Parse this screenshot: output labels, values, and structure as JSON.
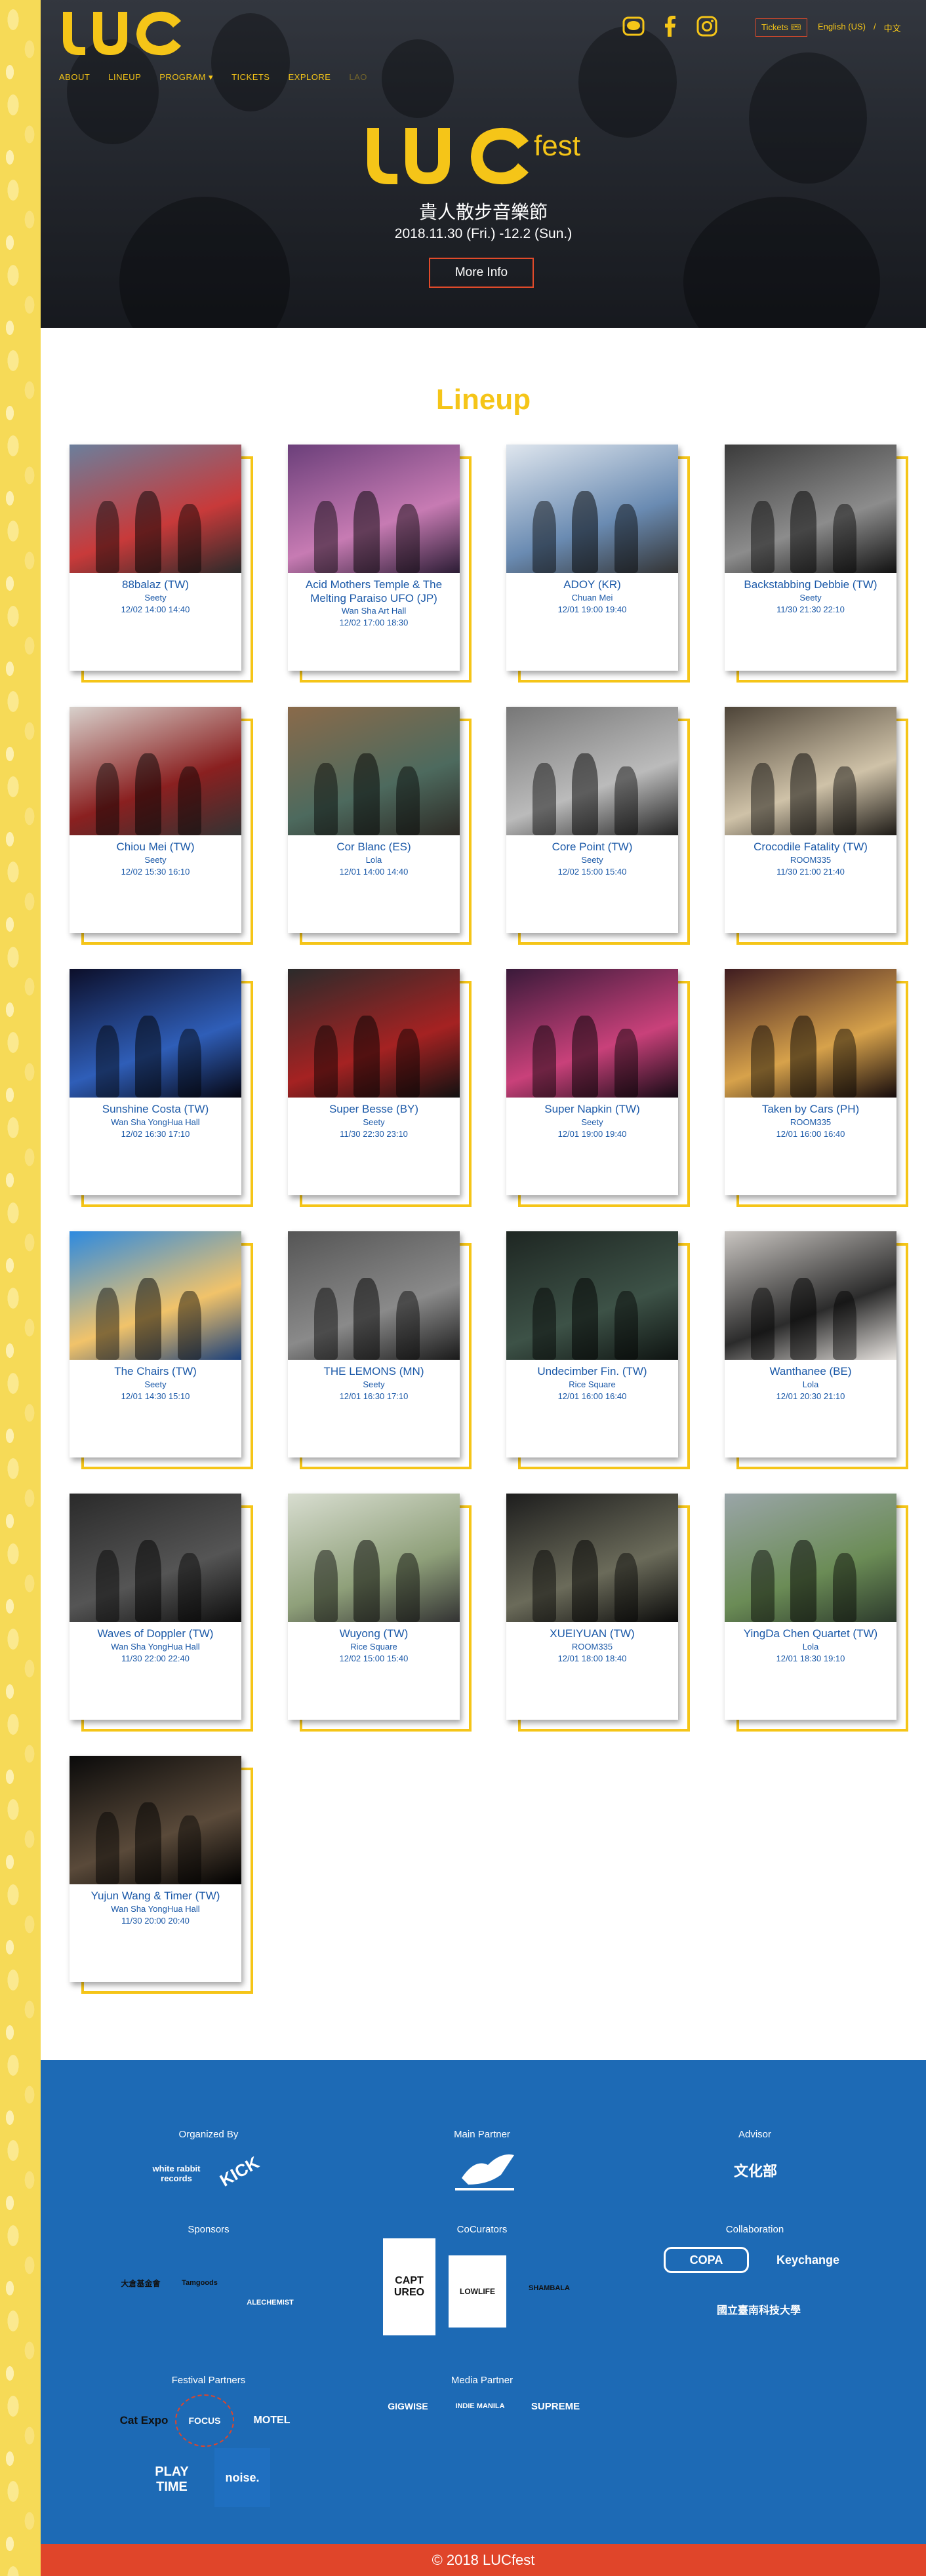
{
  "header": {
    "logo_text": "LUC",
    "nav": [
      "ABOUT",
      "LINEUP",
      "PROGRAM ▾",
      "TICKETS",
      "EXPLORE",
      "LAO"
    ],
    "tickets_label": "Tickets 🎟",
    "lang_en": "English (US)",
    "lang_sep": "/",
    "lang_zh": "中文"
  },
  "hero": {
    "logo_main": "LUC",
    "logo_sub": "fest",
    "subtitle": "貴人散步音樂節",
    "dates": "2018.11.30 (Fri.) -12.2 (Sun.)",
    "more_info": "More Info"
  },
  "lineup": {
    "title": "Lineup",
    "artists": [
      {
        "name": "88balaz (TW)",
        "venue": "Seety",
        "time": "12/02 14:00 14:40"
      },
      {
        "name": "Acid Mothers Temple & The Melting Paraiso UFO (JP)",
        "venue": "Wan Sha Art Hall",
        "time": "12/02 17:00 18:30"
      },
      {
        "name": "ADOY (KR)",
        "venue": "Chuan Mei",
        "time": "12/01 19:00 19:40"
      },
      {
        "name": "Backstabbing Debbie (TW)",
        "venue": "Seety",
        "time": "11/30 21:30 22:10"
      },
      {
        "name": "Chiou Mei (TW)",
        "venue": "Seety",
        "time": "12/02 15:30 16:10"
      },
      {
        "name": "Cor Blanc (ES)",
        "venue": "Lola",
        "time": "12/01 14:00 14:40"
      },
      {
        "name": "Core Point (TW)",
        "venue": "Seety",
        "time": "12/02 15:00 15:40"
      },
      {
        "name": "Crocodile Fatality (TW)",
        "venue": "ROOM335",
        "time": "11/30 21:00 21:40"
      },
      {
        "name": "Sunshine Costa (TW)",
        "venue": "Wan Sha YongHua Hall",
        "time": "12/02 16:30 17:10"
      },
      {
        "name": "Super Besse (BY)",
        "venue": "Seety",
        "time": "11/30 22:30 23:10"
      },
      {
        "name": "Super Napkin (TW)",
        "venue": "Seety",
        "time": "12/01 19:00 19:40"
      },
      {
        "name": "Taken by Cars (PH)",
        "venue": "ROOM335",
        "time": "12/01 16:00 16:40"
      },
      {
        "name": "The Chairs (TW)",
        "venue": "Seety",
        "time": "12/01 14:30 15:10"
      },
      {
        "name": "THE LEMONS (MN)",
        "venue": "Seety",
        "time": "12/01 16:30 17:10"
      },
      {
        "name": "Undecimber Fin. (TW)",
        "venue": "Rice Square",
        "time": "12/01 16:00 16:40"
      },
      {
        "name": "Wanthanee (BE)",
        "venue": "Lola",
        "time": "12/01 20:30 21:10"
      },
      {
        "name": "Waves of Doppler (TW)",
        "venue": "Wan Sha YongHua Hall",
        "time": "11/30 22:00 22:40"
      },
      {
        "name": "Wuyong (TW)",
        "venue": "Rice Square",
        "time": "12/02 15:00 15:40"
      },
      {
        "name": "XUEIYUAN (TW)",
        "venue": "ROOM335",
        "time": "12/01 18:00 18:40"
      },
      {
        "name": "YingDa Chen Quartet (TW)",
        "venue": "Lola",
        "time": "12/01 18:30 19:10"
      },
      {
        "name": "Yujun Wang & Timer (TW)",
        "venue": "Wan Sha YongHua Hall",
        "time": "11/30 20:00 20:40"
      }
    ]
  },
  "sponsors": {
    "organized_by": "Organized By",
    "organized_logos": [
      "white rabbit records",
      "KICK"
    ],
    "main_partner": "Main Partner",
    "advisor": "Advisor",
    "advisor_logo": "文化部",
    "sponsors_h": "Sponsors",
    "sponsor_logos": [
      "大倉基金會",
      "Tamgoods",
      "ALECHEMIST"
    ],
    "cocurators": "CoCurators",
    "cocurator_logos": [
      "CAPT UREO",
      "LOWLIFE",
      "SHAMBALA"
    ],
    "collaboration": "Collaboration",
    "collab_logos": [
      "COPA",
      "Keychange",
      "國立臺南科技大學"
    ],
    "festival_partners": "Festival Partners",
    "festival_logos": [
      "Cat Expo",
      "FOCUS",
      "MOTEL",
      "PLAY TIME",
      "noise."
    ],
    "media_partner": "Media Partner",
    "media_logos": [
      "GIGWISE",
      "INDIE MANILA",
      "SUPREME"
    ]
  },
  "footer": {
    "copyright": "© 2018 LUCfest"
  },
  "colors": {
    "accent_yellow": "#f5c518",
    "accent_red": "#e0452a",
    "blue": "#1d6ab5"
  }
}
